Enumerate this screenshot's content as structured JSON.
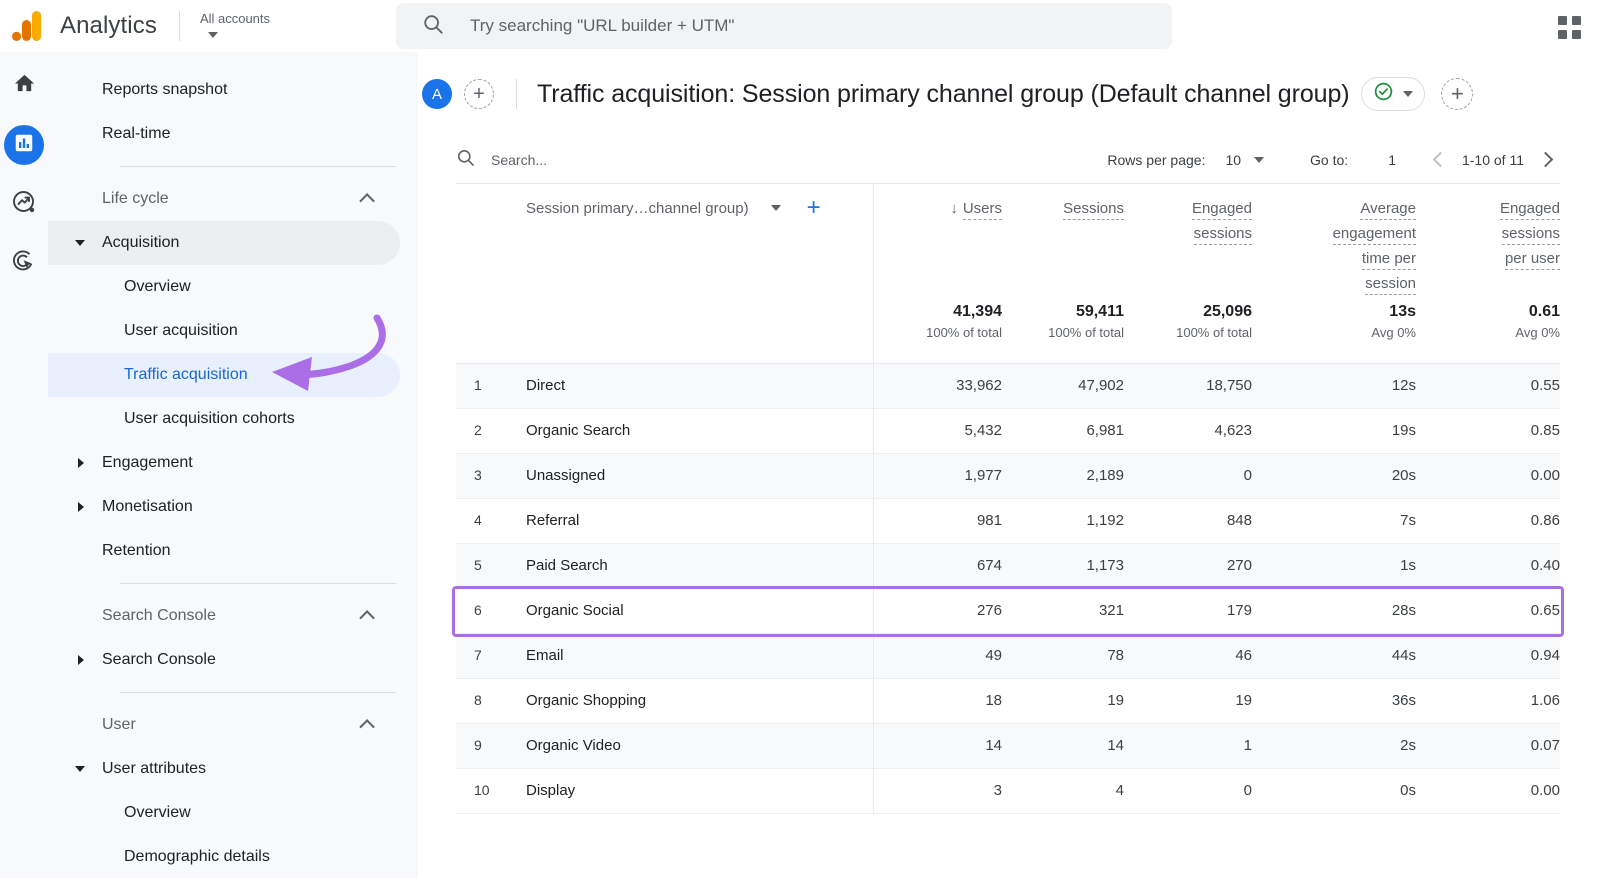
{
  "topbar": {
    "brand": "Analytics",
    "account_label": "All accounts",
    "search_placeholder": "Try searching \"URL builder + UTM\"",
    "search_icon": "search-icon",
    "apps_icon": "apps-grid-icon"
  },
  "rail": [
    {
      "name": "home",
      "icon": "home-icon",
      "active": false
    },
    {
      "name": "reports",
      "icon": "bar-chart-icon",
      "active": true
    },
    {
      "name": "explore",
      "icon": "explore-trend-icon",
      "active": false
    },
    {
      "name": "advertising",
      "icon": "advertising-target-icon",
      "active": false
    }
  ],
  "sidebar": {
    "items": [
      {
        "label": "Reports snapshot",
        "level": "lvl0",
        "state": "normal"
      },
      {
        "label": "Real-time",
        "level": "lvl0",
        "state": "normal"
      },
      {
        "label": "Life cycle",
        "level": "section",
        "state": "section",
        "chevron": "chevron-up-icon"
      },
      {
        "label": "Acquisition",
        "level": "grp",
        "state": "hover",
        "caret": "caret-down-icon"
      },
      {
        "label": "Overview",
        "level": "child",
        "state": "normal"
      },
      {
        "label": "User acquisition",
        "level": "child",
        "state": "normal"
      },
      {
        "label": "Traffic acquisition",
        "level": "child",
        "state": "selected"
      },
      {
        "label": "User acquisition cohorts",
        "level": "child",
        "state": "normal"
      },
      {
        "label": "Engagement",
        "level": "grp",
        "state": "normal",
        "caret": "caret-right-icon"
      },
      {
        "label": "Monetisation",
        "level": "grp",
        "state": "normal",
        "caret": "caret-right-icon"
      },
      {
        "label": "Retention",
        "level": "grp",
        "state": "normal"
      },
      {
        "label": "Search Console",
        "level": "section",
        "state": "section",
        "chevron": "chevron-up-icon"
      },
      {
        "label": "Search Console",
        "level": "grp",
        "state": "normal",
        "caret": "caret-right-icon"
      },
      {
        "label": "User",
        "level": "section",
        "state": "section",
        "chevron": "chevron-up-icon"
      },
      {
        "label": "User attributes",
        "level": "grp",
        "state": "normal",
        "caret": "caret-down-icon"
      },
      {
        "label": "Overview",
        "level": "child",
        "state": "normal"
      },
      {
        "label": "Demographic details",
        "level": "child",
        "state": "normal"
      }
    ]
  },
  "header": {
    "avatar_letter": "A",
    "add_comparison_icon": "plus-dashed-icon",
    "title": "Traffic acquisition: Session primary channel group (Default channel group)",
    "save_state_icon": "check-circle-icon",
    "save_caret_icon": "chevron-down-icon",
    "add_icon": "plus-dashed-icon"
  },
  "table_controls": {
    "search_icon": "search-icon",
    "search_placeholder": "Search...",
    "rows_per_page_label": "Rows per page:",
    "rows_per_page_value": "10",
    "goto_label": "Go to:",
    "goto_value": "1",
    "page_range": "1-10 of 11",
    "prev_icon": "chevron-left-icon",
    "next_icon": "chevron-right-icon"
  },
  "chart_data": {
    "type": "table",
    "title": "Traffic acquisition: Session primary channel group (Default channel group)",
    "dimension_header": "Session primary…channel group)",
    "dimension_caret_icon": "chevron-down-icon",
    "add_dimension_icon": "plus-icon",
    "sort_column": "Users",
    "sort_direction": "desc",
    "sort_arrow_glyph": "↓",
    "columns": [
      {
        "label": "Users",
        "lines": [
          "Users"
        ]
      },
      {
        "label": "Sessions",
        "lines": [
          "Sessions"
        ]
      },
      {
        "label": "Engaged sessions",
        "lines": [
          "Engaged",
          "sessions"
        ]
      },
      {
        "label": "Average engagement time per session",
        "lines": [
          "Average",
          "engagement",
          "time per",
          "session"
        ]
      },
      {
        "label": "Engaged sessions per user",
        "lines": [
          "Engaged",
          "sessions",
          "per user"
        ]
      }
    ],
    "totals": {
      "values": [
        "41,394",
        "59,411",
        "25,096",
        "13s",
        "0.61"
      ],
      "subs": [
        "100% of total",
        "100% of total",
        "100% of total",
        "Avg 0%",
        "Avg 0%"
      ]
    },
    "rows": [
      {
        "index": "1",
        "name": "Direct",
        "values": [
          "33,962",
          "47,902",
          "18,750",
          "12s",
          "0.55"
        ],
        "highlight": false
      },
      {
        "index": "2",
        "name": "Organic Search",
        "values": [
          "5,432",
          "6,981",
          "4,623",
          "19s",
          "0.85"
        ],
        "highlight": false
      },
      {
        "index": "3",
        "name": "Unassigned",
        "values": [
          "1,977",
          "2,189",
          "0",
          "20s",
          "0.00"
        ],
        "highlight": false
      },
      {
        "index": "4",
        "name": "Referral",
        "values": [
          "981",
          "1,192",
          "848",
          "7s",
          "0.86"
        ],
        "highlight": false
      },
      {
        "index": "5",
        "name": "Paid Search",
        "values": [
          "674",
          "1,173",
          "270",
          "1s",
          "0.40"
        ],
        "highlight": false
      },
      {
        "index": "6",
        "name": "Organic Social",
        "values": [
          "276",
          "321",
          "179",
          "28s",
          "0.65"
        ],
        "highlight": true
      },
      {
        "index": "7",
        "name": "Email",
        "values": [
          "49",
          "78",
          "46",
          "44s",
          "0.94"
        ],
        "highlight": false
      },
      {
        "index": "8",
        "name": "Organic Shopping",
        "values": [
          "18",
          "19",
          "19",
          "36s",
          "1.06"
        ],
        "highlight": false
      },
      {
        "index": "9",
        "name": "Organic Video",
        "values": [
          "14",
          "14",
          "1",
          "2s",
          "0.07"
        ],
        "highlight": false
      },
      {
        "index": "10",
        "name": "Display",
        "values": [
          "3",
          "4",
          "0",
          "0s",
          "0.00"
        ],
        "highlight": false
      }
    ]
  },
  "annotation": {
    "arrow_color": "#ab6ee6",
    "highlight_color": "#ab6ee6",
    "points_to": "Traffic acquisition"
  },
  "colors": {
    "accent_blue": "#1a73e8",
    "selected_bg": "#e8f0fe",
    "selected_text": "#1967d2",
    "rail_bg": "#f8f9fa",
    "green_check": "#1e8e3e",
    "logo_orange": "#f29900",
    "logo_orange_dark": "#e8710a"
  }
}
